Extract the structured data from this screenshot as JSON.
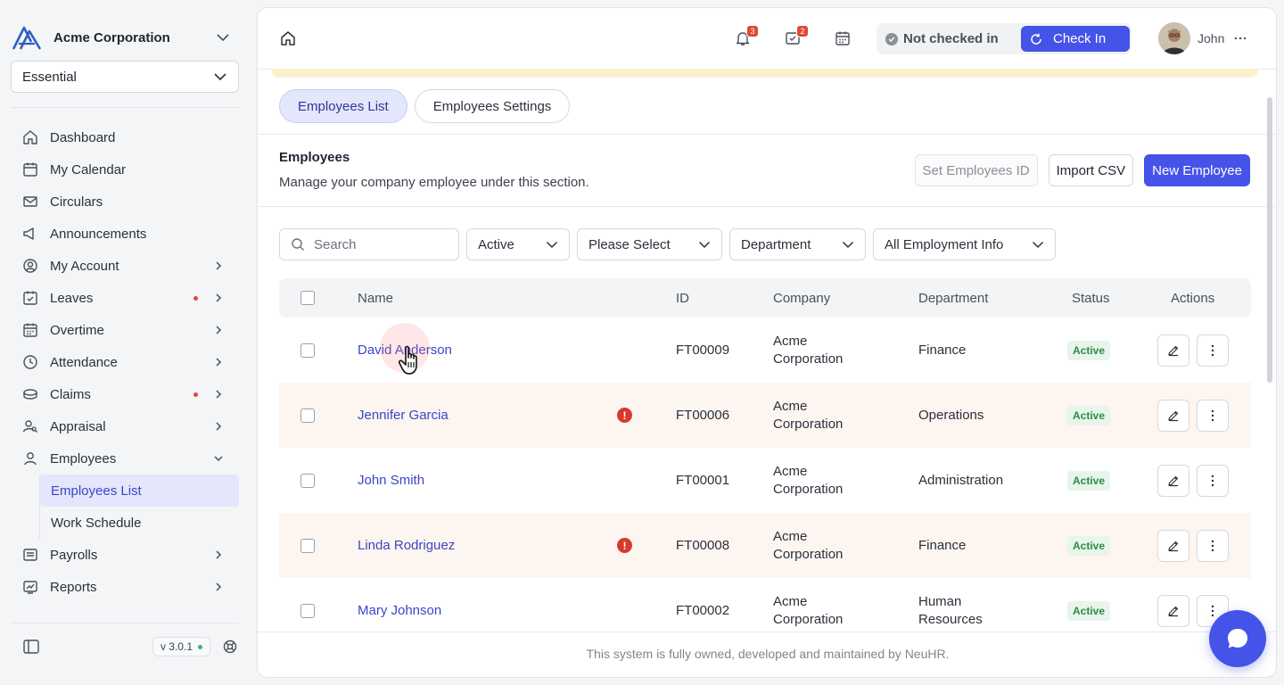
{
  "org": {
    "name": "Acme Corporation"
  },
  "plan": {
    "selected": "Essential"
  },
  "nav": {
    "dashboard": "Dashboard",
    "calendar": "My Calendar",
    "circulars": "Circulars",
    "announcements": "Announcements",
    "account": "My Account",
    "leaves": "Leaves",
    "overtime": "Overtime",
    "attendance": "Attendance",
    "claims": "Claims",
    "appraisal": "Appraisal",
    "employees": "Employees",
    "employees_list": "Employees List",
    "work_schedule": "Work Schedule",
    "payrolls": "Payrolls",
    "reports": "Reports"
  },
  "version": "v 3.0.1",
  "topbar": {
    "notifications_count": "3",
    "inbox_count": "2",
    "checkin_status": "Not checked in",
    "checkin_button": "Check In",
    "user_name": "John"
  },
  "tabs": {
    "list": "Employees List",
    "settings": "Employees Settings"
  },
  "section": {
    "title": "Employees",
    "description": "Manage your company employee under this section."
  },
  "actions": {
    "set_id": "Set Employees ID",
    "import_csv": "Import CSV",
    "new_employee": "New Employee"
  },
  "filters": {
    "search_placeholder": "Search",
    "status": "Active",
    "please_select": "Please Select",
    "department": "Department",
    "employment": "All Employment Info"
  },
  "table": {
    "headers": {
      "name": "Name",
      "id": "ID",
      "company": "Company",
      "department": "Department",
      "status": "Status",
      "actions": "Actions"
    },
    "rows": [
      {
        "name": "David Anderson",
        "id": "FT00009",
        "company_l1": "Acme",
        "company_l2": "Corporation",
        "dept_l1": "Finance",
        "dept_l2": "",
        "status": "Active"
      },
      {
        "name": "Jennifer Garcia",
        "id": "FT00006",
        "company_l1": "Acme",
        "company_l2": "Corporation",
        "dept_l1": "Operations",
        "dept_l2": "",
        "status": "Active"
      },
      {
        "name": "John Smith",
        "id": "FT00001",
        "company_l1": "Acme",
        "company_l2": "Corporation",
        "dept_l1": "Administration",
        "dept_l2": "",
        "status": "Active"
      },
      {
        "name": "Linda Rodriguez",
        "id": "FT00008",
        "company_l1": "Acme",
        "company_l2": "Corporation",
        "dept_l1": "Finance",
        "dept_l2": "",
        "status": "Active"
      },
      {
        "name": "Mary Johnson",
        "id": "FT00002",
        "company_l1": "Acme",
        "company_l2": "Corporation",
        "dept_l1": "Human",
        "dept_l2": "Resources",
        "status": "Active"
      }
    ]
  },
  "alert_mark": "!",
  "footer": "This system is fully owned, developed and maintained by NeuHR."
}
